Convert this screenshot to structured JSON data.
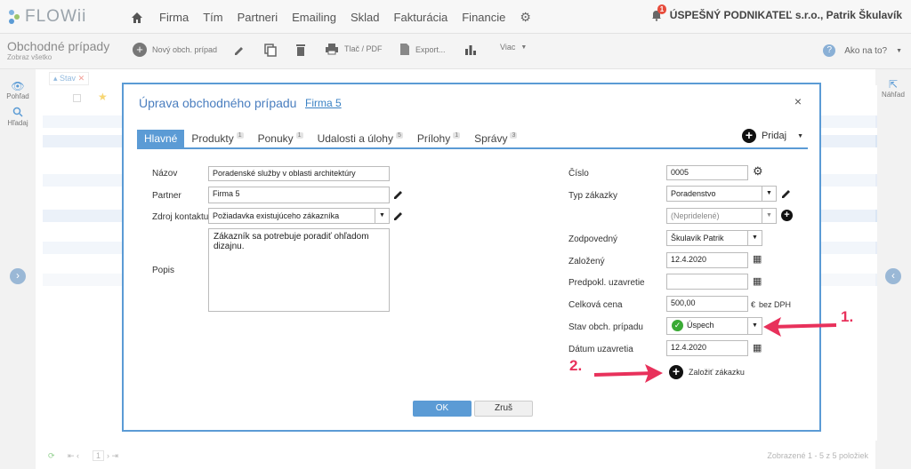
{
  "app": {
    "logo": "FLOWii"
  },
  "nav": {
    "items": [
      "Firma",
      "Tím",
      "Partneri",
      "Emailing",
      "Sklad",
      "Fakturácia",
      "Financie"
    ]
  },
  "user": {
    "notifications": "1",
    "company_user": "ÚSPEŠNÝ PODNIKATEĽ s.r.o., Patrik Škulavík"
  },
  "toolbar": {
    "title": "Obchodné prípady",
    "subtitle": "Zobraz všetko",
    "new_label": "Nový obch. prípad",
    "print_label": "Tlač / PDF",
    "export_label": "Export...",
    "more_label": "Viac",
    "help_label": "Ako na to?"
  },
  "sidebar": {
    "view_label": "Pohľad",
    "search_label": "Hľadaj",
    "preview_label": "Náhľad"
  },
  "filter": {
    "label": "Stav"
  },
  "footer": {
    "page": "1",
    "summary": "Zobrazené 1 - 5 z 5 položiek"
  },
  "modal": {
    "title": "Úprava obchodného prípadu",
    "title_link": "Firma 5",
    "tabs": [
      {
        "label": "Hlavné",
        "count": ""
      },
      {
        "label": "Produkty",
        "count": "1"
      },
      {
        "label": "Ponuky",
        "count": "1"
      },
      {
        "label": "Udalosti a úlohy",
        "count": "5"
      },
      {
        "label": "Prílohy",
        "count": "1"
      },
      {
        "label": "Správy",
        "count": "3"
      }
    ],
    "add_label": "Pridaj",
    "left": {
      "name_label": "Názov",
      "name_value": "Poradenské služby v oblasti architektúry",
      "partner_label": "Partner",
      "partner_value": "Firma 5",
      "source_label": "Zdroj kontaktu",
      "source_value": "Požiadavka existujúceho zákazníka",
      "desc_label": "Popis",
      "desc_value": "Zákazník sa potrebuje poradiť ohľadom dizajnu."
    },
    "right": {
      "number_label": "Číslo",
      "number_value": "0005",
      "type_label": "Typ zákazky",
      "type_value": "Poradenstvo",
      "type2_value": "(Nepridelené)",
      "owner_label": "Zodpovedný",
      "owner_value": "Škulavík Patrik",
      "created_label": "Založený",
      "created_value": "12.4.2020",
      "expected_label": "Predpokl. uzavretie",
      "expected_value": "",
      "price_label": "Celková cena",
      "price_value": "500,00",
      "currency": "€",
      "vat_note": "bez DPH",
      "status_label": "Stav obch. prípadu",
      "status_value": "Úspech",
      "closed_label": "Dátum uzavretia",
      "closed_value": "12.4.2020",
      "create_order_label": "Založiť zákazku"
    },
    "ok_label": "OK",
    "cancel_label": "Zruš"
  },
  "annotations": {
    "a1": "1.",
    "a2": "2."
  },
  "colors": {
    "accent": "#5b9bd5",
    "annotation": "#e8315b",
    "success": "#3aaa35"
  }
}
